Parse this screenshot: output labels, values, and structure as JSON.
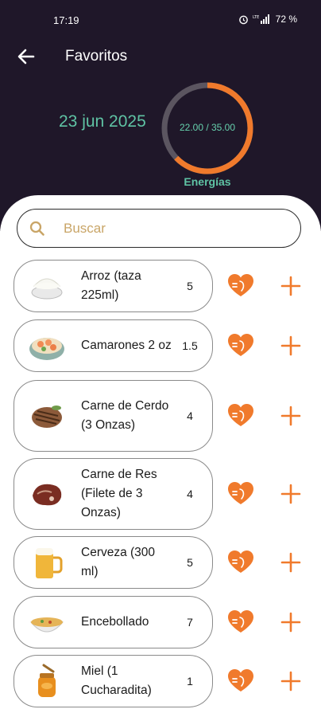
{
  "status": {
    "time": "17:19",
    "battery": "72 %"
  },
  "header": {
    "title": "Favoritos",
    "date": "23 jun 2025",
    "ring_value": "22.00 / 35.00",
    "ring_label": "Energías",
    "ring_progress": 0.6286
  },
  "search": {
    "placeholder": "Buscar"
  },
  "colors": {
    "header_bg": "#1f1729",
    "accent": "#f07a2c",
    "date_green": "#5fc3a4",
    "ring_track": "#5b5560"
  },
  "foods": [
    {
      "name": "Arroz (taza 225ml)",
      "value": "5",
      "icon": "rice-bowl-icon"
    },
    {
      "name": "Camarones 2 oz",
      "value": "1.5",
      "icon": "shrimp-bowl-icon"
    },
    {
      "name": "Carne de Cerdo (3 Onzas)",
      "value": "4",
      "icon": "pork-steak-icon"
    },
    {
      "name": "Carne de Res (Filete de 3 Onzas)",
      "value": "4",
      "icon": "beef-steak-icon"
    },
    {
      "name": "Cerveza (300 ml)",
      "value": "5",
      "icon": "beer-mug-icon"
    },
    {
      "name": "Encebollado",
      "value": "7",
      "icon": "soup-bowl-icon"
    },
    {
      "name": "Miel (1 Cucharadita)",
      "value": "1",
      "icon": "honey-jar-icon"
    }
  ]
}
